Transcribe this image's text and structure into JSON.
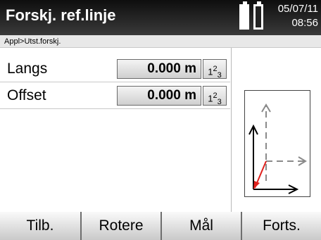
{
  "header": {
    "title": "Forskj. ref.linje",
    "date": "05/07/11",
    "time": "08:56"
  },
  "breadcrumb": "Appl>Utst.forskj.",
  "fields": [
    {
      "label": "Langs",
      "value": "0.000 m",
      "unit_button": "123"
    },
    {
      "label": "Offset",
      "value": "0.000 m",
      "unit_button": "123"
    }
  ],
  "icons": {
    "battery1": "battery-full-icon",
    "battery2": "battery-icon",
    "unit_toggle": "numeric-input-icon",
    "diagram": "offset-reference-line-diagram"
  },
  "softkeys": [
    "Tilb.",
    "Rotere",
    "Mål",
    "Forts."
  ],
  "colors": {
    "header_bg": "#1a1a1a",
    "accent_red": "#e0201c",
    "dashed_axis": "#8a8a8a"
  }
}
